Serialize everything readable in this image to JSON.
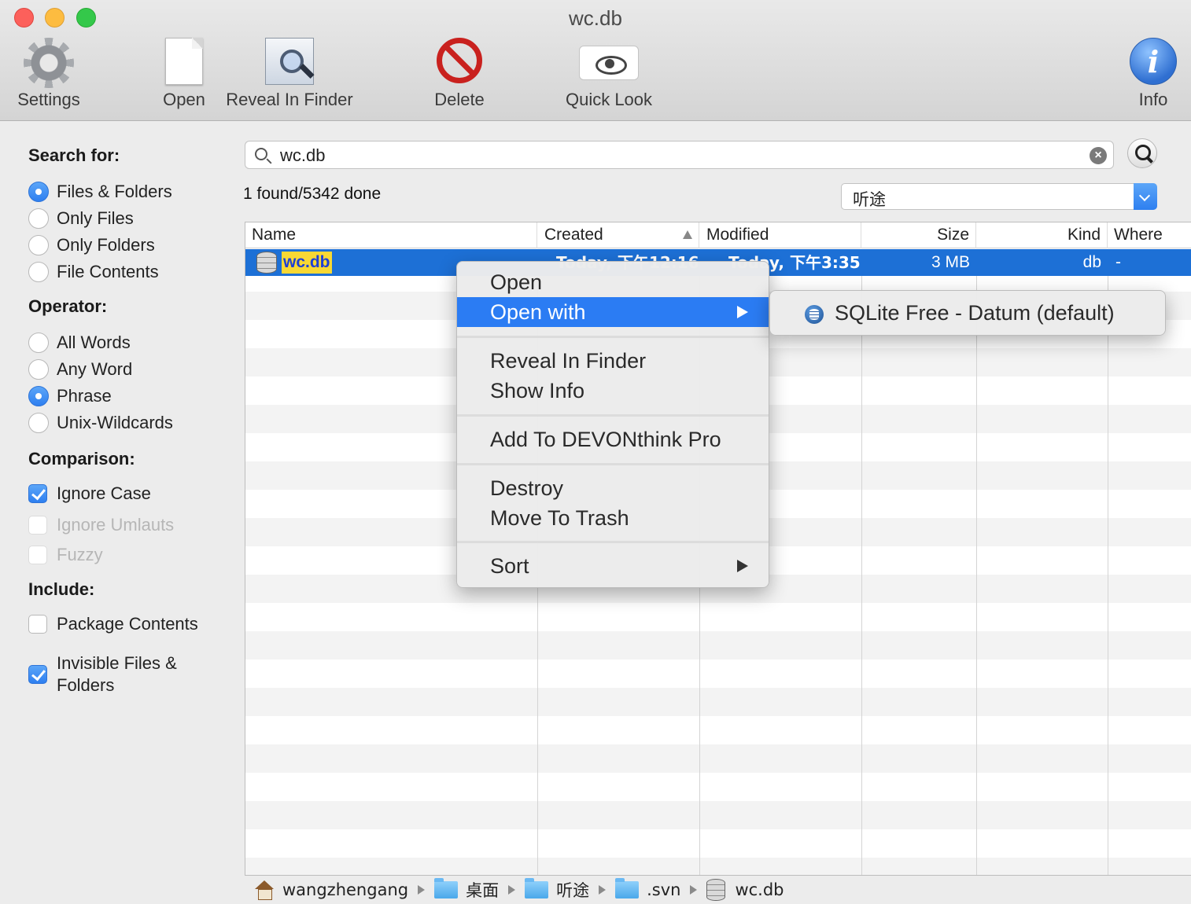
{
  "window": {
    "title": "wc.db"
  },
  "toolbar": {
    "settings_label": "Settings",
    "open_label": "Open",
    "reveal_label": "Reveal In Finder",
    "delete_label": "Delete",
    "quicklook_label": "Quick Look",
    "info_label": "Info"
  },
  "sidebar": {
    "search_for_heading": "Search for:",
    "search_for_options": [
      {
        "label": "Files & Folders",
        "selected": true
      },
      {
        "label": "Only Files",
        "selected": false
      },
      {
        "label": "Only Folders",
        "selected": false
      },
      {
        "label": "File Contents",
        "selected": false
      }
    ],
    "operator_heading": "Operator:",
    "operator_options": [
      {
        "label": "All Words",
        "selected": false
      },
      {
        "label": "Any Word",
        "selected": false
      },
      {
        "label": "Phrase",
        "selected": true
      },
      {
        "label": "Unix-Wildcards",
        "selected": false
      }
    ],
    "comparison_heading": "Comparison:",
    "comparison_options": [
      {
        "label": "Ignore Case",
        "checked": true,
        "enabled": true
      },
      {
        "label": "Ignore Umlauts",
        "checked": false,
        "enabled": false
      },
      {
        "label": "Fuzzy",
        "checked": false,
        "enabled": false
      }
    ],
    "include_heading": "Include:",
    "include_options": [
      {
        "label": "Package Contents",
        "checked": false
      },
      {
        "label": "Invisible Files & Folders",
        "checked": true
      }
    ]
  },
  "search": {
    "query": "wc.db",
    "status": "1 found/5342 done",
    "location": "听途"
  },
  "table": {
    "columns": [
      "Name",
      "Created",
      "Modified",
      "Size",
      "Kind",
      "Where"
    ],
    "rows": [
      {
        "name": "wc.db",
        "created": "Today, 下午12:16",
        "modified": "Today, 下午3:35",
        "size": "3 MB",
        "kind": "db",
        "where": "-"
      }
    ]
  },
  "pathbar": {
    "items": [
      "wangzhengang",
      "桌面",
      "听途",
      ".svn",
      "wc.db"
    ]
  },
  "context_menu": {
    "items": [
      "Open",
      "Open with",
      "Reveal In Finder",
      "Show Info",
      "Add To DEVONthink Pro",
      "Destroy",
      "Move To Trash",
      "Sort"
    ],
    "highlighted": "Open with",
    "submenu_item": "SQLite Free - Datum (default)"
  },
  "colors": {
    "selection": "#1d70d6",
    "menu_highlight": "#2b7cf3",
    "match_highlight": "#f8d834",
    "accent": "#2e7ff0"
  }
}
